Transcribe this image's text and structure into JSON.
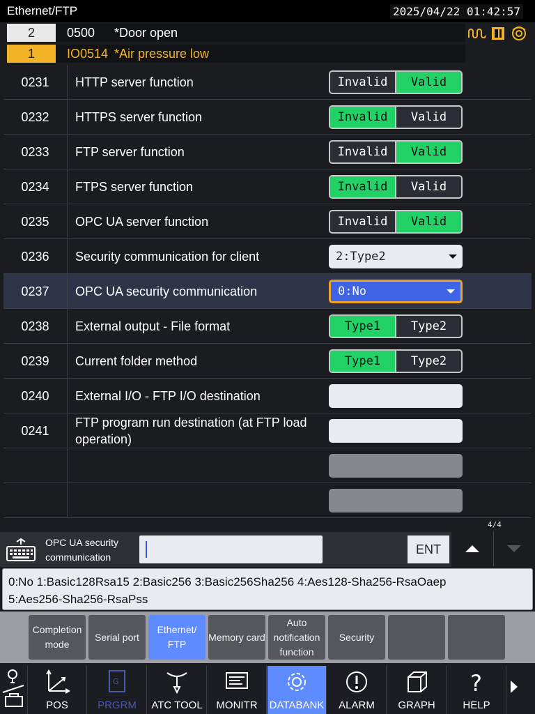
{
  "header": {
    "title": "Ethernet/FTP",
    "datetime": "2025/04/22 01:42:57"
  },
  "alarms": [
    {
      "num": "2",
      "code": "0500",
      "msg": "*Door open"
    },
    {
      "num": "1",
      "code": "IO0514",
      "msg": "*Air pressure low"
    }
  ],
  "status_icons": [
    "spindle-wave-icon",
    "door-icon",
    "target-icon"
  ],
  "params": [
    {
      "no": "0231",
      "label": "HTTP server function",
      "kind": "toggle",
      "options": [
        "Invalid",
        "Valid"
      ],
      "selected": 1
    },
    {
      "no": "0232",
      "label": "HTTPS server function",
      "kind": "toggle",
      "options": [
        "Invalid",
        "Valid"
      ],
      "selected": 0
    },
    {
      "no": "0233",
      "label": "FTP server function",
      "kind": "toggle",
      "options": [
        "Invalid",
        "Valid"
      ],
      "selected": 1
    },
    {
      "no": "0234",
      "label": "FTPS server function",
      "kind": "toggle",
      "options": [
        "Invalid",
        "Valid"
      ],
      "selected": 0
    },
    {
      "no": "0235",
      "label": "OPC UA server function",
      "kind": "toggle",
      "options": [
        "Invalid",
        "Valid"
      ],
      "selected": 1
    },
    {
      "no": "0236",
      "label": "Security communication for client",
      "kind": "dropdown",
      "value": "2:Type2"
    },
    {
      "no": "0237",
      "label": "OPC UA security communication",
      "kind": "dropdown",
      "value": "0:No",
      "focused": true
    },
    {
      "no": "0238",
      "label": "External output - File format",
      "kind": "toggle",
      "options": [
        "Type1",
        "Type2"
      ],
      "selected": 0
    },
    {
      "no": "0239",
      "label": "Current folder method",
      "kind": "toggle",
      "options": [
        "Type1",
        "Type2"
      ],
      "selected": 0
    },
    {
      "no": "0240",
      "label": "External I/O - FTP I/O destination",
      "kind": "text",
      "value": ""
    },
    {
      "no": "0241",
      "label": "FTP program run destination (at FTP load operation)",
      "kind": "text",
      "value": ""
    },
    {
      "no": "",
      "label": "",
      "kind": "disabled"
    },
    {
      "no": "",
      "label": "",
      "kind": "disabled"
    }
  ],
  "input": {
    "label": "OPC UA security communication",
    "value": "",
    "enter_label": "ENT"
  },
  "pager": {
    "page": "4/4"
  },
  "hint": {
    "line1": "0:No  1:Basic128Rsa15  2:Basic256  3:Basic256Sha256  4:Aes128-Sha256-RsaOaep",
    "line2": "5:Aes256-Sha256-RsaPss"
  },
  "softkeys": [
    {
      "label": "Completion mode",
      "active": false
    },
    {
      "label": "Serial port",
      "active": false
    },
    {
      "label": "Ethernet/ FTP",
      "active": true
    },
    {
      "label": "Memory card",
      "active": false
    },
    {
      "label": "Auto notification function",
      "active": false
    },
    {
      "label": "Security",
      "active": false
    },
    {
      "label": "",
      "active": false
    },
    {
      "label": "",
      "active": false
    }
  ],
  "mainmenu": [
    {
      "label": "POS",
      "icon": "axes-icon",
      "active": false,
      "disabled": false
    },
    {
      "label": "PRGRM",
      "icon": "program-icon",
      "active": false,
      "disabled": true
    },
    {
      "label": "ATC TOOL",
      "icon": "tool-icon",
      "active": false,
      "disabled": false
    },
    {
      "label": "MONITR",
      "icon": "monitor-icon",
      "active": false,
      "disabled": false
    },
    {
      "label": "DATABANK",
      "icon": "gear-icon",
      "active": true,
      "disabled": false
    },
    {
      "label": "ALARM",
      "icon": "alarm-icon",
      "active": false,
      "disabled": false
    },
    {
      "label": "GRAPH",
      "icon": "cube-icon",
      "active": false,
      "disabled": false
    },
    {
      "label": "HELP",
      "icon": "help-icon",
      "active": false,
      "disabled": false
    }
  ],
  "colors": {
    "on": "#22d267",
    "focus_border": "#f0a422",
    "active": "#5e8bff",
    "alarm": "#f3b327"
  }
}
